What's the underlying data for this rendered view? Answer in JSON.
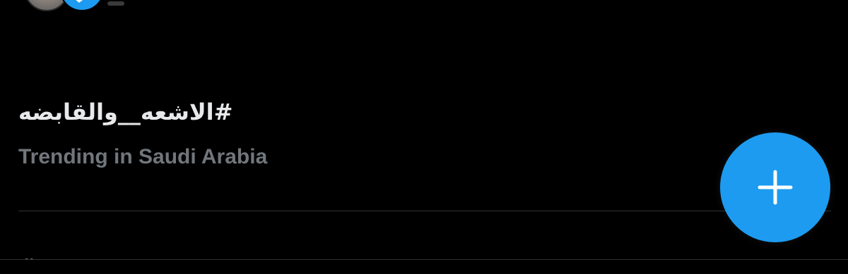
{
  "trend": {
    "title": "#الاشعه__والقابضه",
    "subtitle": "Trending in Saudi Arabia"
  },
  "next_trend": {
    "title": "#"
  },
  "fab": {
    "icon": "plus-icon"
  },
  "colors": {
    "background": "#000000",
    "primary_text": "#e7e9ea",
    "secondary_text": "#71767b",
    "accent": "#1d9bf0",
    "divider": "#2f3336"
  }
}
